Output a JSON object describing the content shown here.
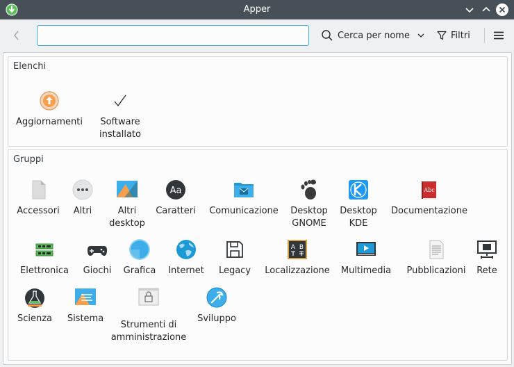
{
  "window": {
    "title": "Apper"
  },
  "toolbar": {
    "search_value": "",
    "search_mode_label": "Cerca per nome",
    "filters_label": "Filtri"
  },
  "lists": {
    "title": "Elenchi",
    "items": [
      {
        "label": "Aggiornamenti",
        "icon": "updates-icon"
      },
      {
        "label": "Software installato",
        "icon": "installed-check-icon"
      }
    ]
  },
  "groups": {
    "title": "Gruppi",
    "items": [
      {
        "label": "Accessori",
        "icon": "accessories-icon"
      },
      {
        "label": "Altri",
        "icon": "others-icon"
      },
      {
        "label": "Altri desktop",
        "icon": "other-desktops-icon"
      },
      {
        "label": "Caratteri",
        "icon": "fonts-icon"
      },
      {
        "label": "Comunicazione",
        "icon": "communication-folder-icon"
      },
      {
        "label": "Desktop GNOME",
        "icon": "gnome-foot-icon"
      },
      {
        "label": "Desktop KDE",
        "icon": "kde-icon"
      },
      {
        "label": "Documentazione",
        "icon": "documentation-book-icon"
      },
      {
        "label": "Elettronica",
        "icon": "electronics-icon"
      },
      {
        "label": "Giochi",
        "icon": "gamepad-icon"
      },
      {
        "label": "Grafica",
        "icon": "graphics-icon"
      },
      {
        "label": "Internet",
        "icon": "internet-globe-icon"
      },
      {
        "label": "Legacy",
        "icon": "legacy-floppy-icon"
      },
      {
        "label": "Localizzazione",
        "icon": "localization-icon"
      },
      {
        "label": "Multimedia",
        "icon": "multimedia-icon"
      },
      {
        "label": "Pubblicazioni",
        "icon": "publishing-icon"
      },
      {
        "label": "Rete",
        "icon": "network-icon"
      },
      {
        "label": "Scienza",
        "icon": "science-flask-icon"
      },
      {
        "label": "Sistema",
        "icon": "system-icon"
      },
      {
        "label": "Strumenti di amministrazione",
        "icon": "admin-tools-lock-icon"
      },
      {
        "label": "Sviluppo",
        "icon": "development-icon"
      }
    ]
  },
  "colors": {
    "accent": "#3daee9",
    "titlebar": "#475057",
    "window_bg": "#eff0f1",
    "view_bg": "#fcfcfc"
  }
}
